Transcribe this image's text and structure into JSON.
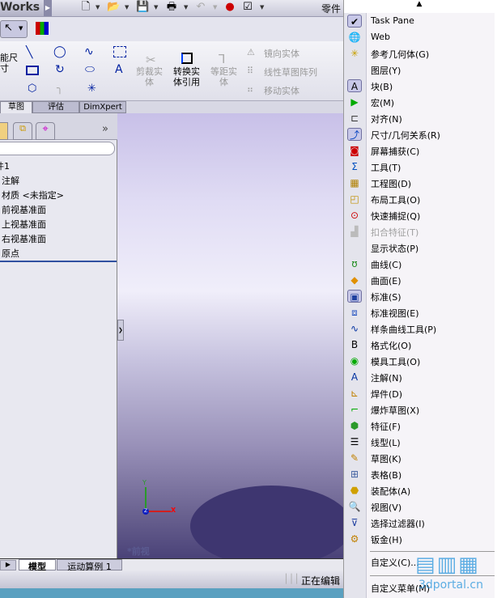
{
  "titlebar": {
    "app": "Works",
    "doc_title": "零件"
  },
  "command_manager": {
    "smart_dim": "能尺\n寸",
    "trim": "剪裁实\n体",
    "convert": "转换实\n体引用",
    "offset": "等距实\n体",
    "mirror": "镜向实体",
    "linear_pattern": "线性草图阵列",
    "move": "移动实体"
  },
  "tabs": [
    "草图",
    "评估",
    "DimXpert"
  ],
  "tree": {
    "items": [
      "件1",
      "注解",
      "材质 <未指定>",
      "前视基准面",
      "上视基准面",
      "右视基准面",
      "原点"
    ],
    "more": "»"
  },
  "viewport": {
    "view_label": "*前视",
    "axes": {
      "x": "X",
      "y": "Y",
      "z": "Z"
    }
  },
  "bottom_tabs": [
    "模型",
    "运动算例 1"
  ],
  "status": {
    "text": "正在编辑"
  },
  "menu": {
    "items": [
      {
        "label": "Task Pane",
        "icon": "check-icon",
        "checked": true
      },
      {
        "label": "Web",
        "icon": "globe-icon"
      },
      {
        "label": "参考几何体(G)",
        "icon": "reference-geometry-icon"
      },
      {
        "label": "图层(Y)",
        "icon": ""
      },
      {
        "label": "块(B)",
        "icon": "block-icon",
        "checked": true
      },
      {
        "label": "宏(M)",
        "icon": "macro-icon"
      },
      {
        "label": "对齐(N)",
        "icon": "align-icon"
      },
      {
        "label": "尺寸/几何关系(R)",
        "icon": "dimension-icon",
        "checked": true
      },
      {
        "label": "屏幕捕获(C)",
        "icon": "screen-capture-icon"
      },
      {
        "label": "工具(T)",
        "icon": "tools-icon"
      },
      {
        "label": "工程图(D)",
        "icon": "drawing-icon"
      },
      {
        "label": "布局工具(O)",
        "icon": "layout-icon"
      },
      {
        "label": "快速捕捉(Q)",
        "icon": "quick-snap-icon"
      },
      {
        "label": "扣合特征(T)",
        "icon": "fastening-icon",
        "disabled": true
      },
      {
        "label": "显示状态(P)",
        "icon": ""
      },
      {
        "label": "曲线(C)",
        "icon": "curve-icon"
      },
      {
        "label": "曲面(E)",
        "icon": "surface-icon"
      },
      {
        "label": "标准(S)",
        "icon": "standard-icon",
        "checked": true
      },
      {
        "label": "标准视图(E)",
        "icon": "standard-views-icon"
      },
      {
        "label": "样条曲线工具(P)",
        "icon": "spline-icon"
      },
      {
        "label": "格式化(O)",
        "icon": "format-icon"
      },
      {
        "label": "模具工具(O)",
        "icon": "mold-icon"
      },
      {
        "label": "注解(N)",
        "icon": "annotation-icon"
      },
      {
        "label": "焊件(D)",
        "icon": "weldment-icon"
      },
      {
        "label": "爆炸草图(X)",
        "icon": "explode-sketch-icon"
      },
      {
        "label": "特征(F)",
        "icon": "features-icon"
      },
      {
        "label": "线型(L)",
        "icon": "line-format-icon"
      },
      {
        "label": "草图(K)",
        "icon": "sketch-icon"
      },
      {
        "label": "表格(B)",
        "icon": "table-icon"
      },
      {
        "label": "装配体(A)",
        "icon": "assembly-icon"
      },
      {
        "label": "视图(V)",
        "icon": "view-icon"
      },
      {
        "label": "选择过滤器(I)",
        "icon": "selection-filter-icon"
      },
      {
        "label": "钣金(H)",
        "icon": "sheet-metal-icon"
      }
    ],
    "customize": "自定义(C)...",
    "customize_menu": "自定义菜单(M)"
  },
  "watermark": {
    "title": "三维网",
    "url": "3dportal.cn"
  }
}
